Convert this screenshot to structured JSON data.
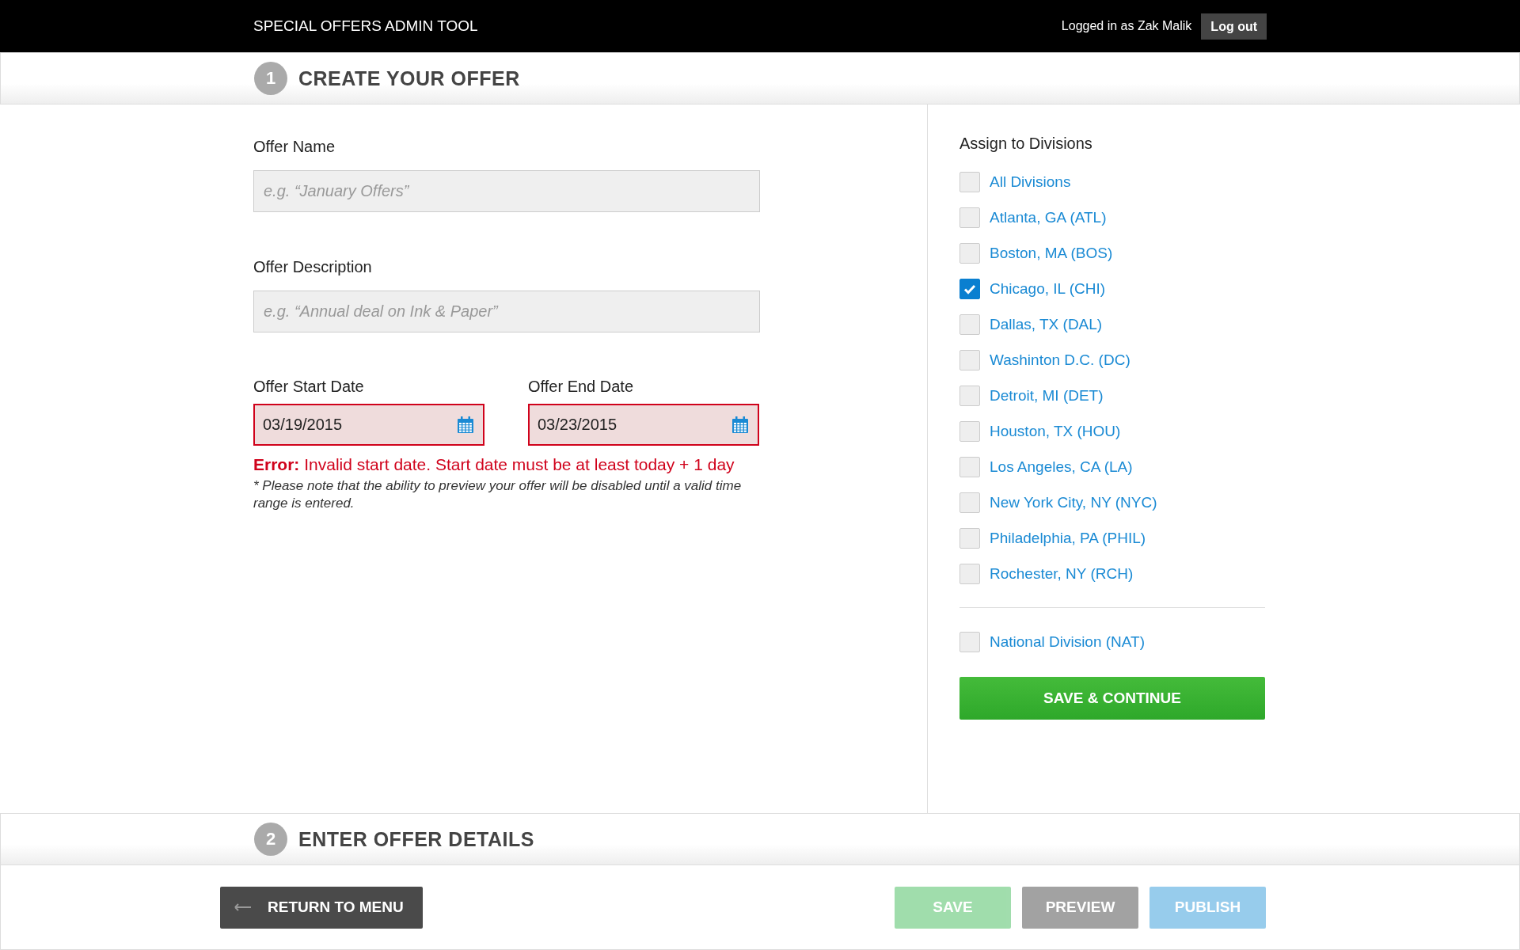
{
  "header": {
    "title": "SPECIAL OFFERS ADMIN TOOL",
    "user_text": "Logged in as Zak Malik",
    "logout": "Log out"
  },
  "steps": [
    {
      "number": "1",
      "title": "CREATE YOUR OFFER"
    },
    {
      "number": "2",
      "title": "ENTER OFFER DETAILS"
    }
  ],
  "form": {
    "offer_name": {
      "label": "Offer Name",
      "placeholder": "e.g. “January Offers”"
    },
    "offer_description": {
      "label": "Offer Description",
      "placeholder": "e.g. “Annual deal on Ink & Paper”"
    },
    "dates": [
      {
        "label": "Offer Start Date",
        "value": "03/19/2015",
        "invalid": true
      },
      {
        "label": "Offer End Date",
        "value": "03/23/2015",
        "invalid": true
      }
    ],
    "error": "**Error:** Invalid start date. Start date must be at least today + 1 day",
    "note": "* Please note that the ability to preview your offer will be disabled until a valid time range is entered."
  },
  "divisions": {
    "title": "Assign to Divisions",
    "items": [
      {
        "label": "All Divisions",
        "checked": false
      },
      {
        "label": "Atlanta, GA (ATL)",
        "checked": false
      },
      {
        "label": "Boston, MA (BOS)",
        "checked": false
      },
      {
        "label": "Chicago, IL (CHI)",
        "checked": true
      },
      {
        "label": "Dallas, TX (DAL)",
        "checked": false
      },
      {
        "label": "Washinton D.C. (DC)",
        "checked": false
      },
      {
        "label": "Detroit, MI (DET)",
        "checked": false
      },
      {
        "label": "Houston, TX (HOU)",
        "checked": false
      },
      {
        "label": "Los Angeles, CA (LA)",
        "checked": false
      },
      {
        "label": "New York City, NY (NYC)",
        "checked": false
      },
      {
        "label": "Philadelphia, PA (PHIL)",
        "checked": false
      },
      {
        "label": "Rochester, NY (RCH)",
        "checked": false
      }
    ],
    "extra": [
      {
        "label": "National Division (NAT)",
        "checked": false
      }
    ],
    "submit": "SAVE & CONTINUE"
  },
  "footer": {
    "return": "RETURN TO MENU",
    "actions": [
      {
        "label": "SAVE",
        "kind": "save",
        "disabled": true
      },
      {
        "label": "PREVIEW",
        "kind": "preview",
        "disabled": true
      },
      {
        "label": "PUBLISH",
        "kind": "publish",
        "disabled": true
      }
    ]
  }
}
